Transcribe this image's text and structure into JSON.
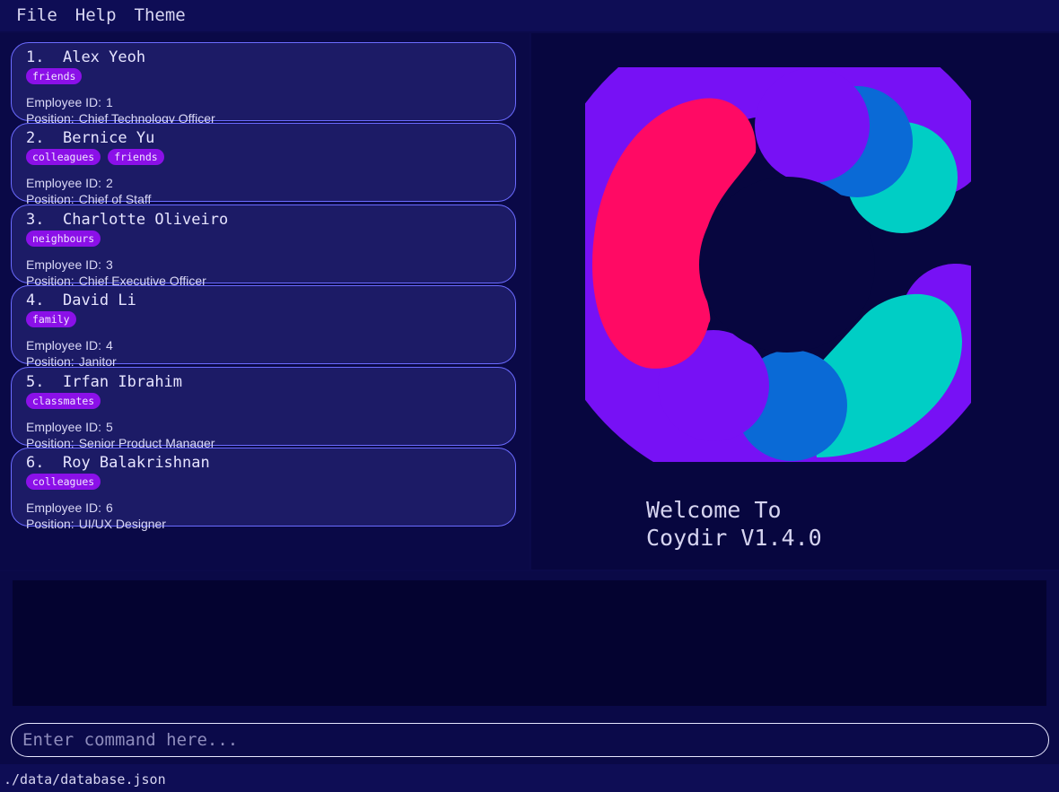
{
  "menu": {
    "file": "File",
    "help": "Help",
    "theme": "Theme"
  },
  "persons": [
    {
      "index": "1.",
      "name": "Alex Yeoh",
      "tags": [
        "friends"
      ],
      "employee_id_label": "Employee ID:",
      "employee_id": "1",
      "position_label": "Position:",
      "position": "Chief Technology Officer"
    },
    {
      "index": "2.",
      "name": "Bernice Yu",
      "tags": [
        "colleagues",
        "friends"
      ],
      "employee_id_label": "Employee ID:",
      "employee_id": "2",
      "position_label": "Position:",
      "position": "Chief of Staff"
    },
    {
      "index": "3.",
      "name": "Charlotte Oliveiro",
      "tags": [
        "neighbours"
      ],
      "employee_id_label": "Employee ID:",
      "employee_id": "3",
      "position_label": "Position:",
      "position": "Chief Executive Officer"
    },
    {
      "index": "4.",
      "name": "David Li",
      "tags": [
        "family"
      ],
      "employee_id_label": "Employee ID:",
      "employee_id": "4",
      "position_label": "Position:",
      "position": "Janitor"
    },
    {
      "index": "5.",
      "name": "Irfan Ibrahim",
      "tags": [
        "classmates"
      ],
      "employee_id_label": "Employee ID:",
      "employee_id": "5",
      "position_label": "Position:",
      "position": "Senior Product Manager"
    },
    {
      "index": "6.",
      "name": "Roy Balakrishnan",
      "tags": [
        "colleagues"
      ],
      "employee_id_label": "Employee ID:",
      "employee_id": "6",
      "position_label": "Position:",
      "position": "UI/UX Designer"
    }
  ],
  "welcome": {
    "line1": "Welcome To",
    "line2": "Coydir V1.4.0",
    "logo_icon": "coydir-logo-icon"
  },
  "result_display": {
    "text": ""
  },
  "command_box": {
    "placeholder": "Enter command here...",
    "value": ""
  },
  "status_bar": {
    "path": "./data/database.json"
  },
  "colors": {
    "background": "#0b0a4a",
    "card": "#1c1b66",
    "card_border": "#6b6bff",
    "tag": "#8b10e8",
    "logo_pink": "#ff0a64",
    "logo_violet": "#7711f5",
    "logo_blue": "#0a6ad6",
    "logo_teal": "#00cec5"
  }
}
